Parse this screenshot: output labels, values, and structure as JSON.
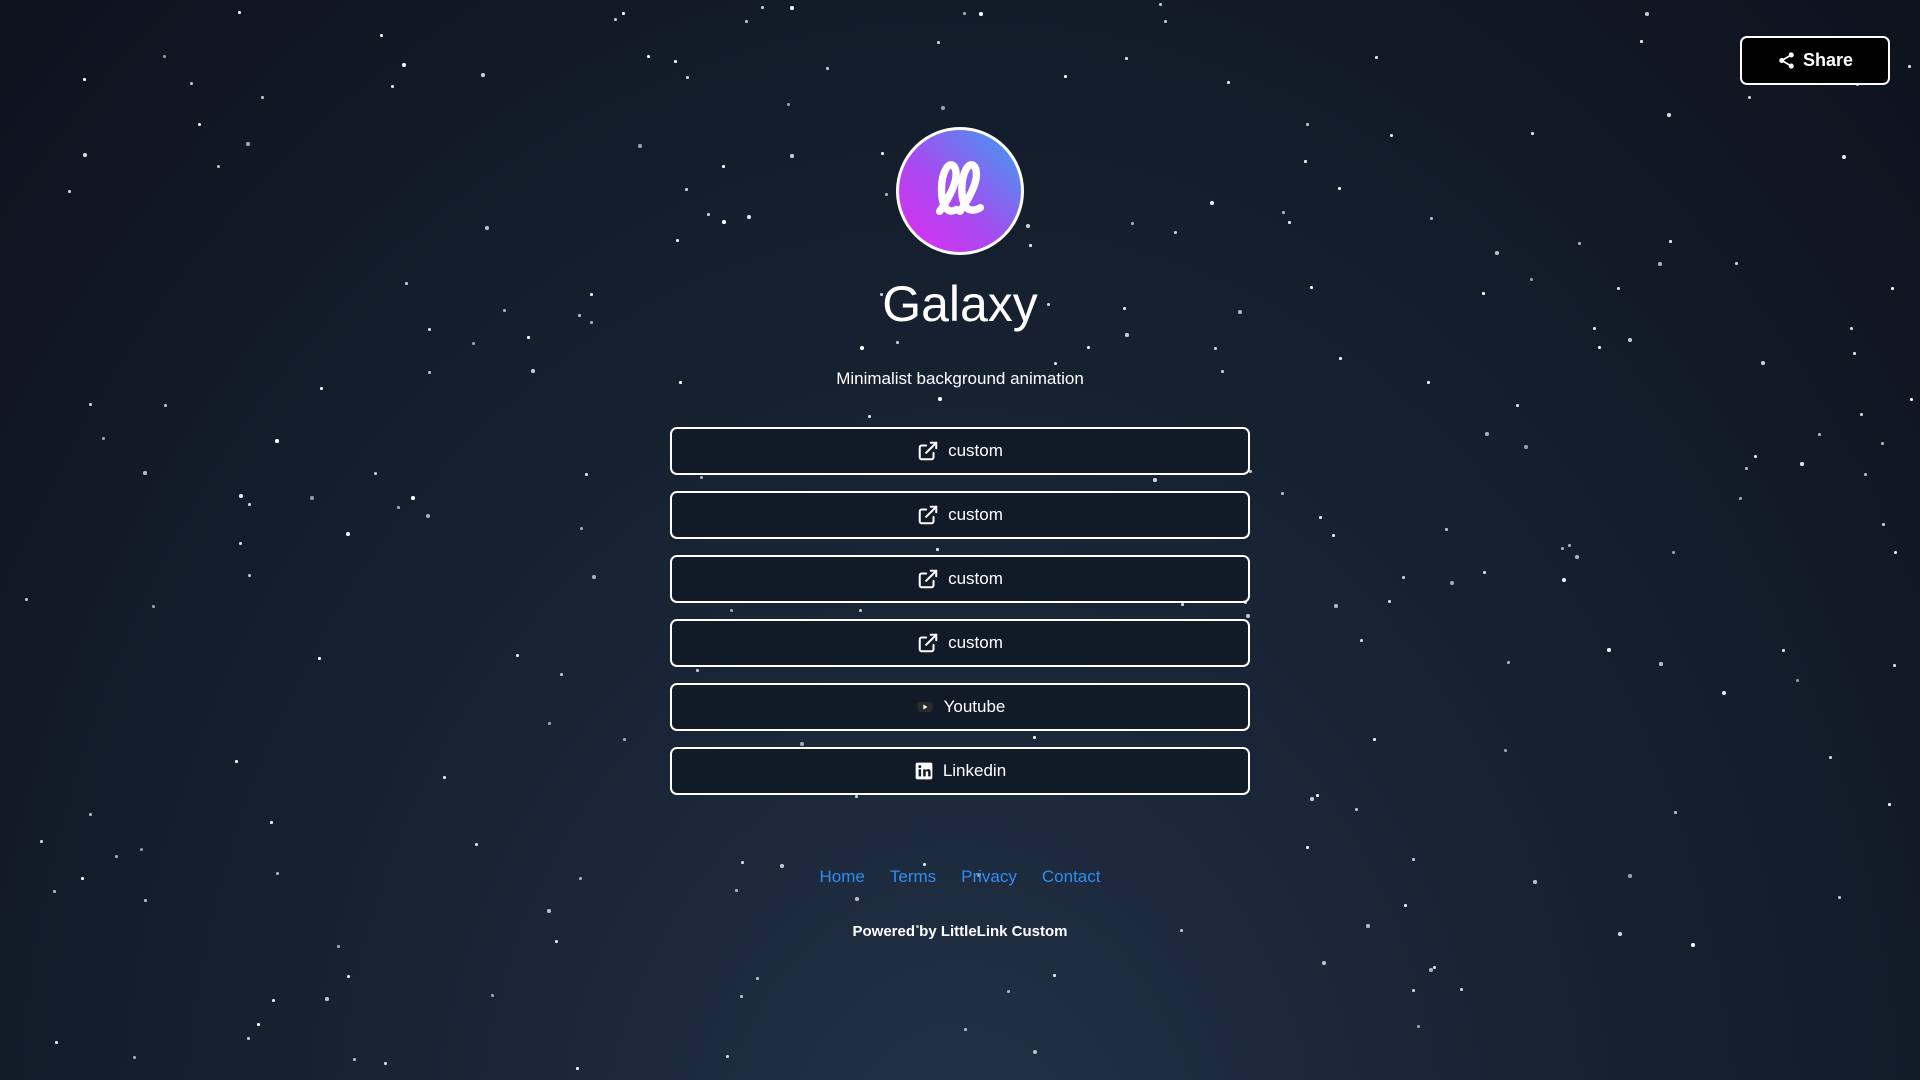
{
  "share_button": {
    "label": "Share",
    "icon": "share-icon"
  },
  "profile": {
    "avatar_icon": "littlelink-logo",
    "name": "Galaxy",
    "tagline": "Minimalist background animation"
  },
  "links": [
    {
      "label": "custom",
      "icon": "external-link-icon"
    },
    {
      "label": "custom",
      "icon": "external-link-icon"
    },
    {
      "label": "custom",
      "icon": "external-link-icon"
    },
    {
      "label": "custom",
      "icon": "external-link-icon"
    },
    {
      "label": "Youtube",
      "icon": "youtube-icon"
    },
    {
      "label": "Linkedin",
      "icon": "linkedin-icon"
    }
  ],
  "footer": {
    "links": [
      "Home",
      "Terms",
      "Privacy",
      "Contact"
    ],
    "powered_by": "Powered by LittleLink Custom"
  },
  "colors": {
    "background_top": "#0d131d",
    "background_bottom": "#223247",
    "footer_link": "#2f8df2",
    "avatar_gradient": [
      "#e12bf0",
      "#3aa0ef"
    ]
  }
}
